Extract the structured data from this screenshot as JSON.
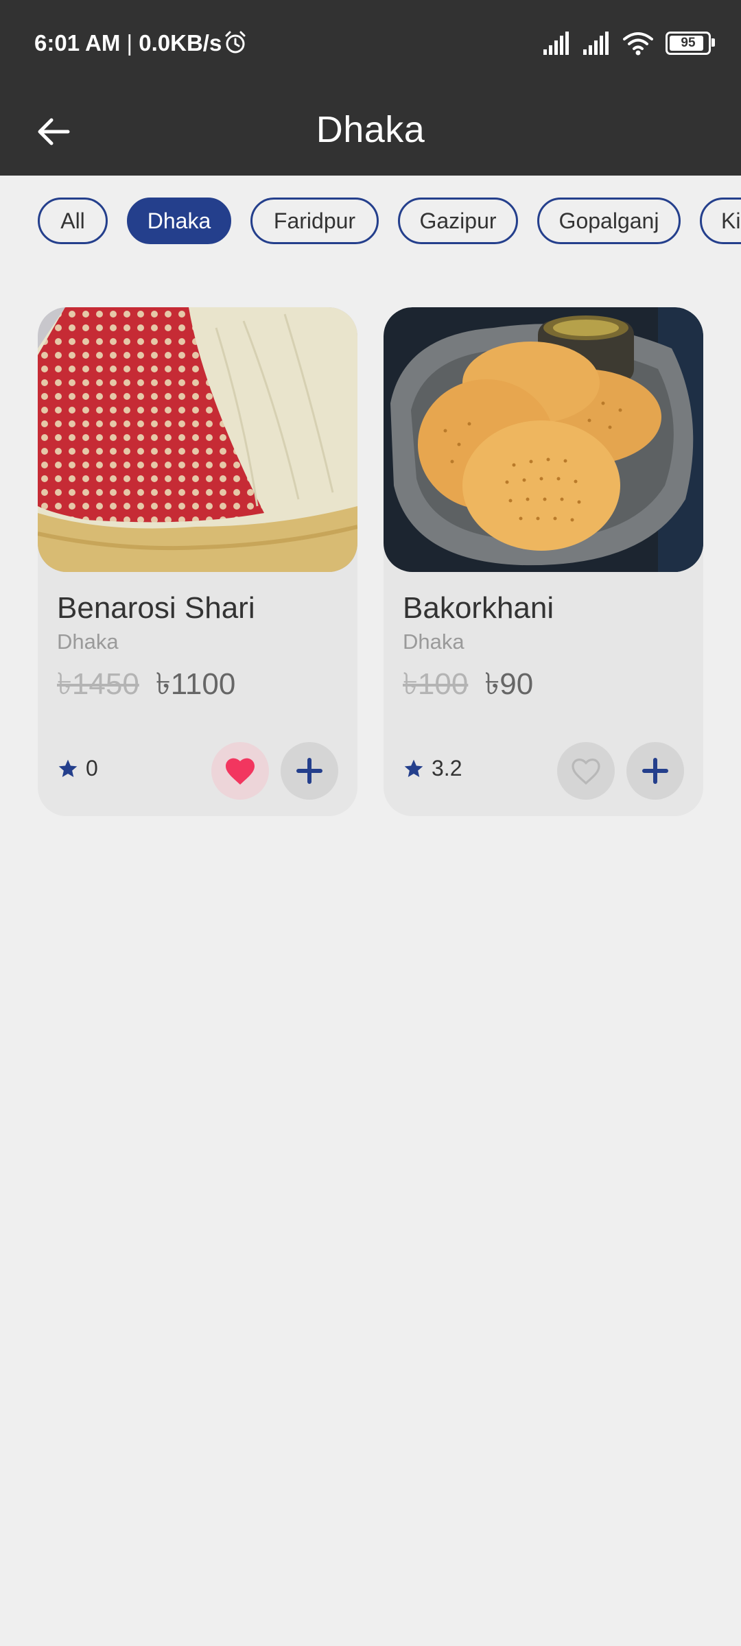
{
  "status": {
    "time": "6:01 AM",
    "separator": " | ",
    "speed": "0.0KB/s",
    "battery": "95"
  },
  "appbar": {
    "title": "Dhaka"
  },
  "chips": [
    {
      "label": "All",
      "active": false
    },
    {
      "label": "Dhaka",
      "active": true
    },
    {
      "label": "Faridpur",
      "active": false
    },
    {
      "label": "Gazipur",
      "active": false
    },
    {
      "label": "Gopalganj",
      "active": false
    },
    {
      "label": "Kishoreganj",
      "active": false
    }
  ],
  "products": [
    {
      "name": "Benarosi Shari",
      "location": "Dhaka",
      "old_price": "৳1450",
      "new_price": "৳1100",
      "rating": "0",
      "favorited": true
    },
    {
      "name": "Bakorkhani",
      "location": "Dhaka",
      "old_price": "৳100",
      "new_price": "৳90",
      "rating": "3.2",
      "favorited": false
    }
  ],
  "colors": {
    "accent": "#243f8c",
    "favorite": "#f2365f",
    "appbar": "#323232",
    "background": "#efefef"
  }
}
